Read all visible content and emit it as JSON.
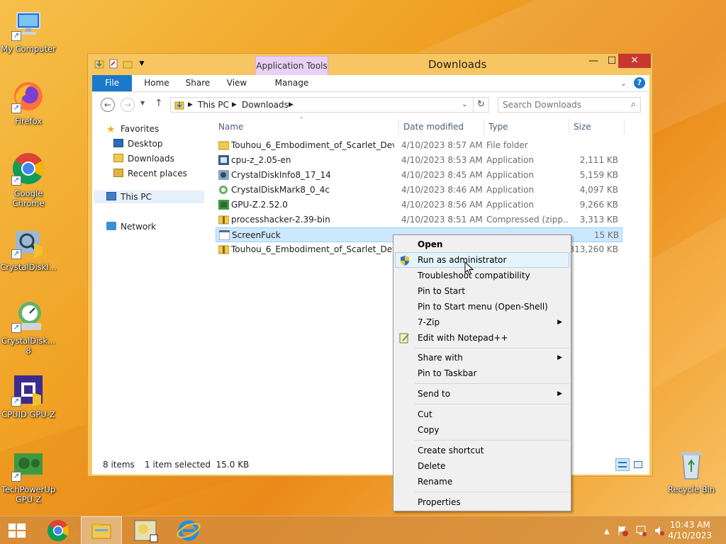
{
  "desktop": {
    "icons": [
      {
        "label": "My Computer"
      },
      {
        "label": "Firefox"
      },
      {
        "label": "Google Chrome"
      },
      {
        "label": "CrystalDiskI..."
      },
      {
        "label": "CrystalDisk...\n8"
      },
      {
        "label": "CPUID GPU-Z"
      },
      {
        "label": "TechPowerUp GPU-Z"
      },
      {
        "label": "Recycle Bin"
      }
    ]
  },
  "window": {
    "title": "Downloads",
    "context_tab_group": "Application Tools",
    "tabs": [
      {
        "label": "File"
      },
      {
        "label": "Home"
      },
      {
        "label": "Share"
      },
      {
        "label": "View"
      },
      {
        "label": "Manage"
      }
    ],
    "address": {
      "segments": [
        "This PC",
        "Downloads"
      ]
    },
    "search": {
      "placeholder": "Search Downloads"
    },
    "nav": {
      "favorites": "Favorites",
      "desktop": "Desktop",
      "downloads": "Downloads",
      "recent": "Recent places",
      "thispc": "This PC",
      "network": "Network"
    },
    "columns": {
      "name": "Name",
      "date": "Date modified",
      "type": "Type",
      "size": "Size"
    },
    "files": [
      {
        "name": "Touhou_6_Embodiment_of_Scarlet_Devil...",
        "date": "4/10/2023 8:57 AM",
        "type": "File folder",
        "size": "",
        "icon": "folder-icon"
      },
      {
        "name": "cpu-z_2.05-en",
        "date": "4/10/2023 8:53 AM",
        "type": "Application",
        "size": "2,111 KB",
        "icon": "app-icon"
      },
      {
        "name": "CrystalDiskInfo8_17_14",
        "date": "4/10/2023 8:45 AM",
        "type": "Application",
        "size": "5,159 KB",
        "icon": "app-icon"
      },
      {
        "name": "CrystalDiskMark8_0_4c",
        "date": "4/10/2023 8:46 AM",
        "type": "Application",
        "size": "4,097 KB",
        "icon": "app-icon"
      },
      {
        "name": "GPU-Z.2.52.0",
        "date": "4/10/2023 8:56 AM",
        "type": "Application",
        "size": "9,266 KB",
        "icon": "app-icon"
      },
      {
        "name": "processhacker-2.39-bin",
        "date": "4/10/2023 8:51 AM",
        "type": "Compressed (zipp...",
        "size": "3,313 KB",
        "icon": "zip-icon"
      },
      {
        "name": "ScreenFuck",
        "date": "",
        "type": "",
        "size": "15 KB",
        "icon": "app-icon",
        "selected": true
      },
      {
        "name": "Touhou_6_Embodiment_of_Scarlet_Devil...",
        "date": "",
        "type": "",
        "size": "313,260 KB",
        "icon": "zip-icon"
      }
    ],
    "status": {
      "count": "8 items",
      "selection": "1 item selected  15.0 KB"
    }
  },
  "context_menu": {
    "items": [
      {
        "label": "Open",
        "bold": true
      },
      {
        "label": "Run as administrator",
        "hover": true,
        "icon": "shield-icon"
      },
      {
        "label": "Troubleshoot compatibility"
      },
      {
        "label": "Pin to Start"
      },
      {
        "label": "Pin to Start menu (Open-Shell)"
      },
      {
        "label": "7-Zip",
        "submenu": true
      },
      {
        "label": "Edit with Notepad++",
        "icon": "notepad-icon"
      },
      {
        "label": "Share with",
        "submenu": true
      },
      {
        "label": "Pin to Taskbar"
      },
      {
        "label": "Send to",
        "submenu": true
      },
      {
        "label": "Cut"
      },
      {
        "label": "Copy"
      },
      {
        "label": "Create shortcut"
      },
      {
        "label": "Delete"
      },
      {
        "label": "Rename"
      },
      {
        "label": "Properties"
      }
    ]
  },
  "taskbar": {
    "clock": {
      "time": "10:43 AM",
      "date": "4/10/2023"
    }
  },
  "colors": {
    "accent": "#1979ca",
    "selection": "#cce8ff",
    "close": "#c7372f",
    "app_tools": "#e9d0f5"
  }
}
